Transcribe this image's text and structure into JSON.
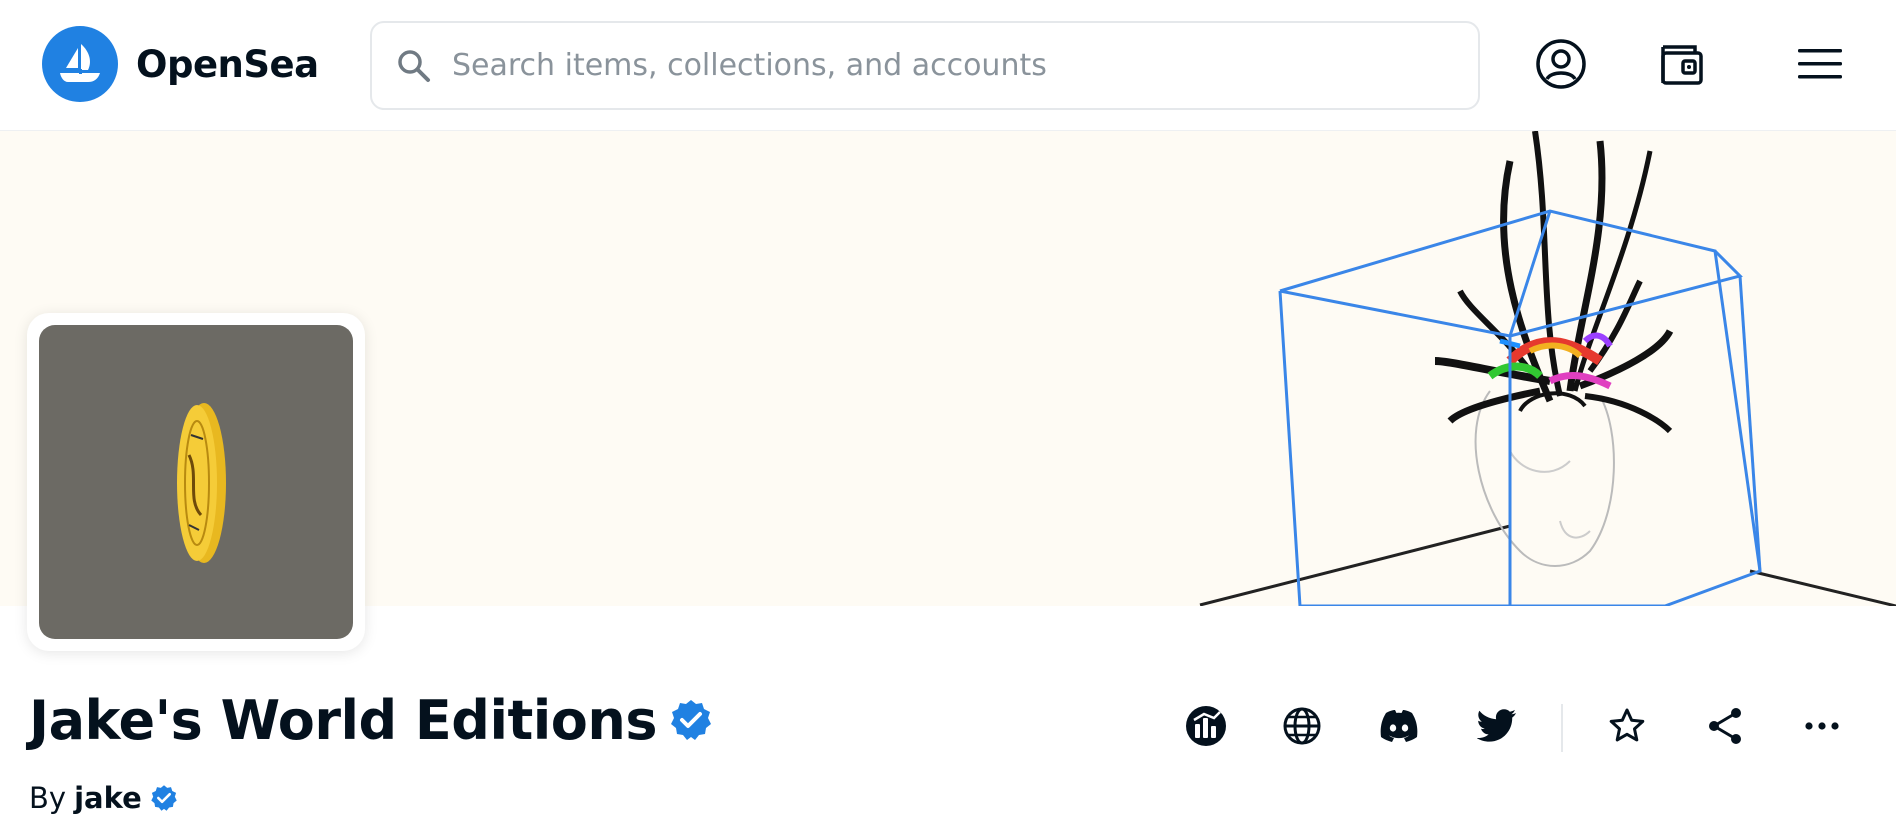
{
  "header": {
    "brand_name": "OpenSea",
    "search_placeholder": "Search items, collections, and accounts",
    "search_value": "",
    "icons": [
      "profile-icon",
      "wallet-icon",
      "menu-icon"
    ]
  },
  "collection": {
    "title": "Jake's World Editions",
    "by_label": "By",
    "creator": "jake",
    "verified": true
  },
  "actions": [
    "activity-icon",
    "website-icon",
    "discord-icon",
    "twitter-icon",
    "watchlist-star-icon",
    "share-icon",
    "more-icon"
  ],
  "colors": {
    "brand": "#2081e2",
    "text": "#04111d",
    "muted": "#8a939b",
    "banner_bg": "#fefbf4",
    "avatar_bg": "#6c6a64",
    "coin": "#f2c230"
  }
}
